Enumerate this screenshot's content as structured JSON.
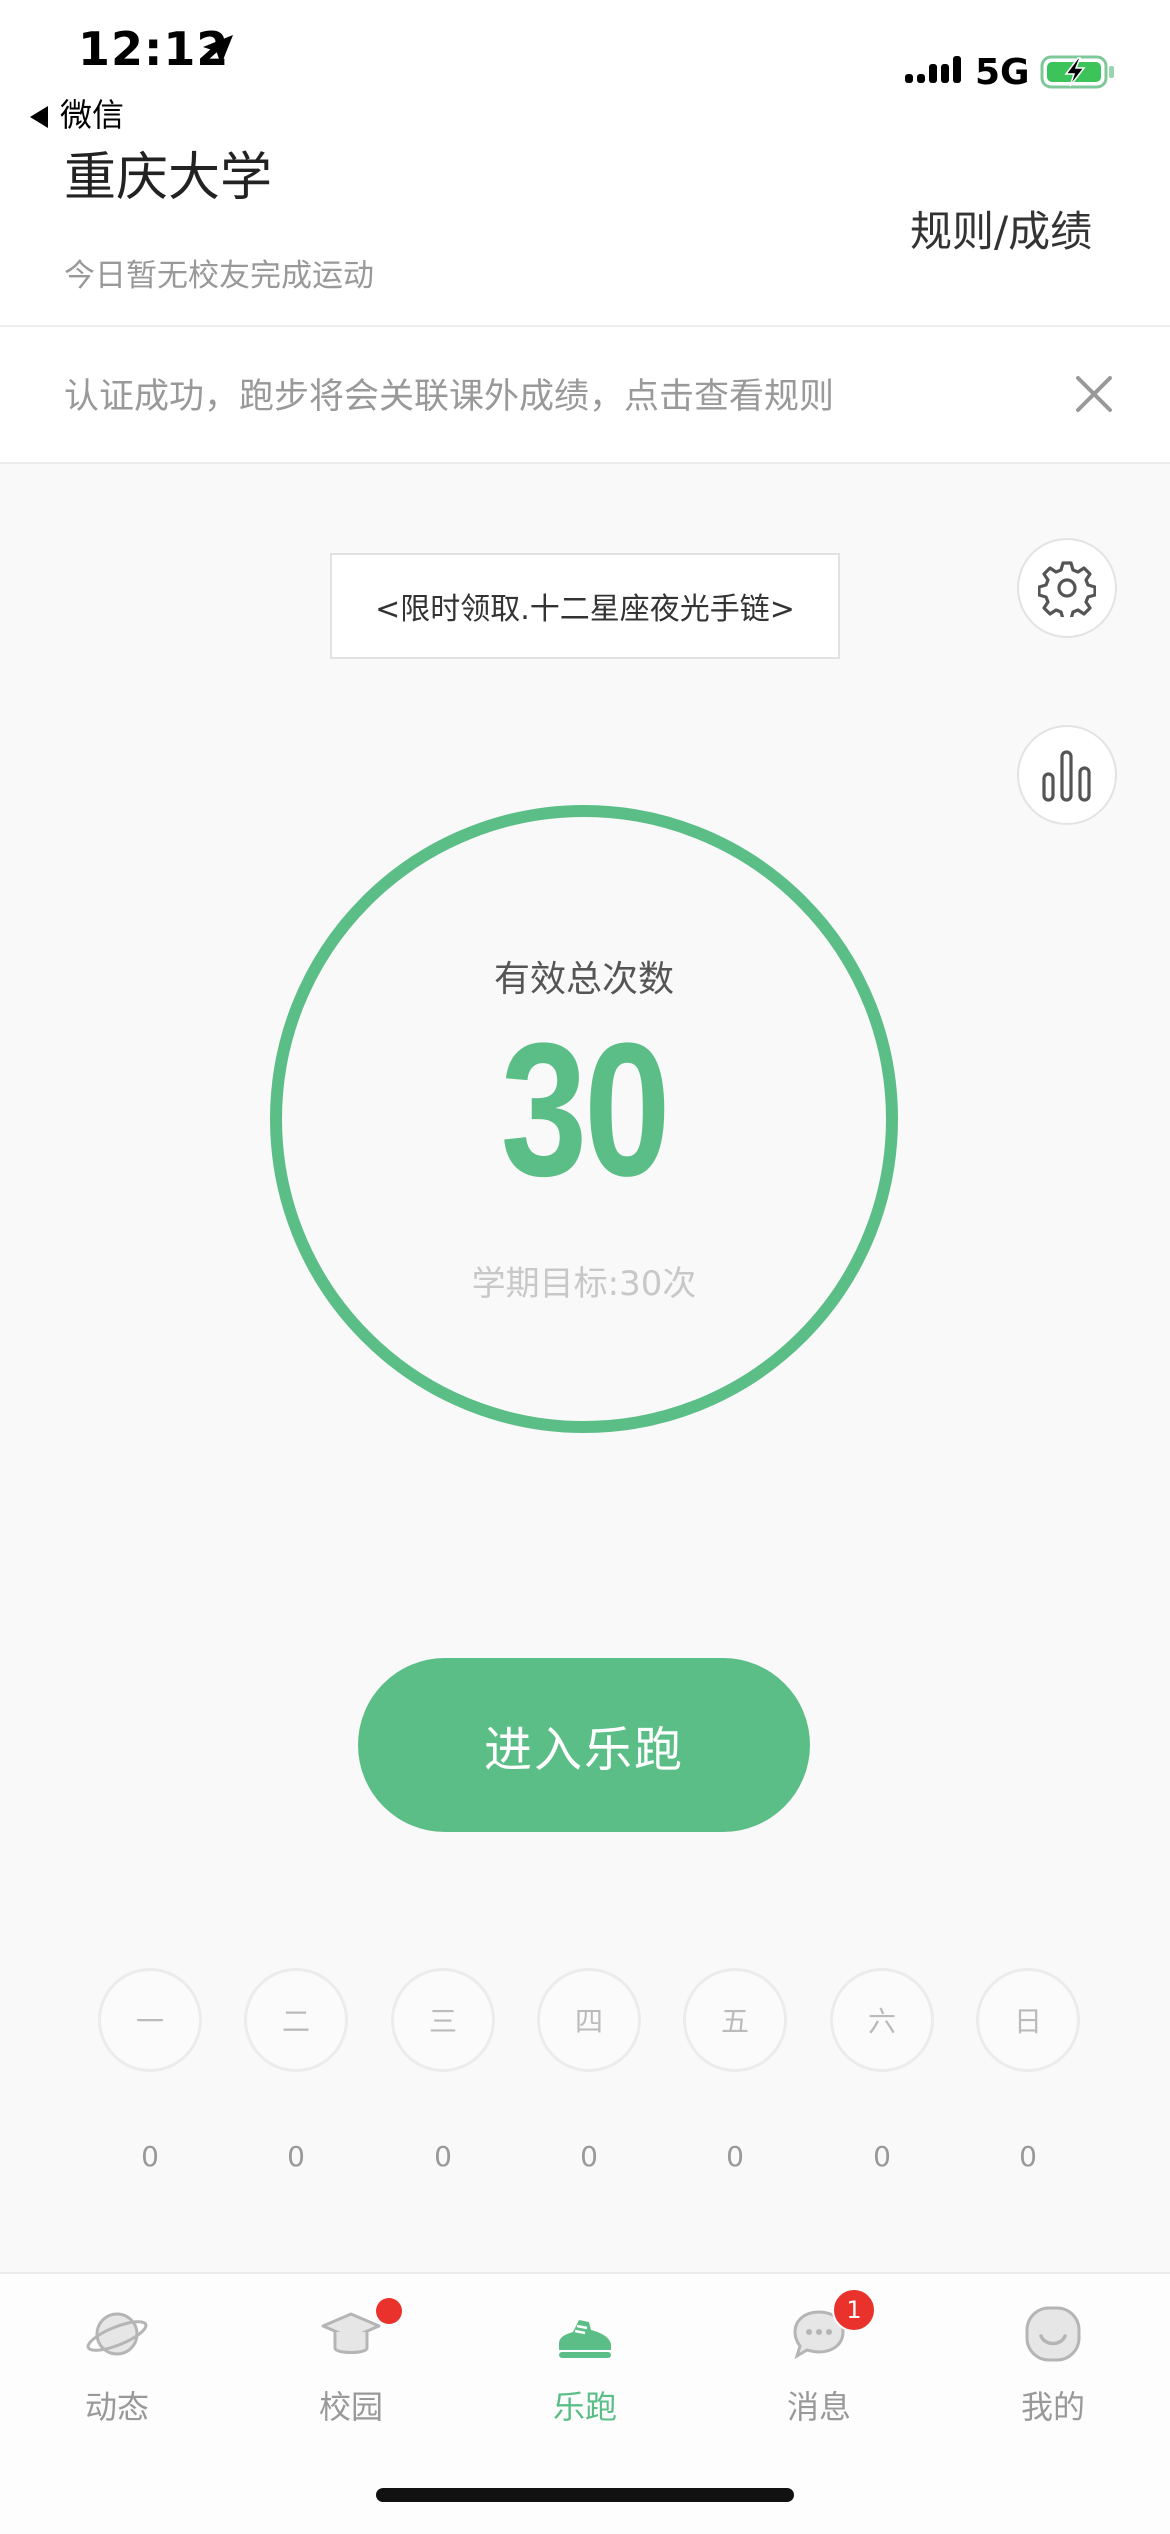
{
  "status_bar": {
    "time": "12:12",
    "back_label": "微信",
    "network": "5G"
  },
  "header": {
    "school": "重庆大学",
    "subtitle": "今日暂无校友完成运动",
    "rules_link": "规则/成绩"
  },
  "notice": {
    "text": "认证成功，跑步将会关联课外成绩，点击查看规则"
  },
  "promo": {
    "label": "<限时领取.十二星座夜光手链>"
  },
  "stats": {
    "label": "有效总次数",
    "count": "30",
    "goal": "学期目标:30次",
    "progress": 1.0
  },
  "cta": {
    "label": "进入乐跑"
  },
  "weekdays": [
    {
      "day": "一",
      "count": "0"
    },
    {
      "day": "二",
      "count": "0"
    },
    {
      "day": "三",
      "count": "0"
    },
    {
      "day": "四",
      "count": "0"
    },
    {
      "day": "五",
      "count": "0"
    },
    {
      "day": "六",
      "count": "0"
    },
    {
      "day": "日",
      "count": "0"
    }
  ],
  "tabs": [
    {
      "label": "动态",
      "icon": "planet-icon"
    },
    {
      "label": "校园",
      "icon": "graduation-cap-icon",
      "badge_dot": true
    },
    {
      "label": "乐跑",
      "icon": "sneaker-icon",
      "active": true
    },
    {
      "label": "消息",
      "icon": "chat-bubble-icon",
      "badge": "1"
    },
    {
      "label": "我的",
      "icon": "smiley-icon"
    }
  ],
  "colors": {
    "accent": "#5cbe87",
    "badge": "#e8322b",
    "muted": "#999999"
  }
}
